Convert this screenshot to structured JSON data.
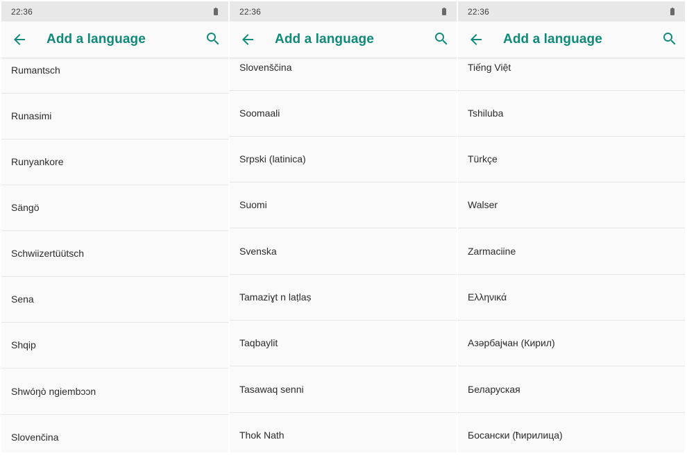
{
  "colors": {
    "accent": "#0f8a7a",
    "status_bar": "#e8e8e8",
    "background": "#fafafa",
    "divider": "#e6e6e6",
    "text": "#2b2b2b"
  },
  "screens": [
    {
      "status_time": "22:36",
      "title": "Add a language",
      "icons": {
        "back": "arrow-back-icon",
        "search": "search-icon",
        "battery": "battery-icon"
      },
      "languages": [
        "Rumantsch",
        "Runasimi",
        "Runyankore",
        "Sängö",
        "Schwiizertüütsch",
        "Sena",
        "Shqip",
        "Shwóŋò ngiembɔɔn",
        "Slovenčina"
      ]
    },
    {
      "status_time": "22:36",
      "title": "Add a language",
      "icons": {
        "back": "arrow-back-icon",
        "search": "search-icon",
        "battery": "battery-icon"
      },
      "languages": [
        "Slovenščina",
        "Soomaali",
        "Srpski (latinica)",
        "Suomi",
        "Svenska",
        "Tamaziɣt n laṭlaṣ",
        "Taqbaylit",
        "Tasawaq senni",
        "Thok Nath"
      ]
    },
    {
      "status_time": "22:36",
      "title": "Add a language",
      "icons": {
        "back": "arrow-back-icon",
        "search": "search-icon",
        "battery": "battery-icon"
      },
      "languages": [
        "Tiếng Việt",
        "Tshiluba",
        "Türkçe",
        "Walser",
        "Zarmaciine",
        "Ελληνικά",
        "Азәрбајҹан (Кирил)",
        "Беларуская",
        "Босански (ћирилица)"
      ]
    }
  ]
}
